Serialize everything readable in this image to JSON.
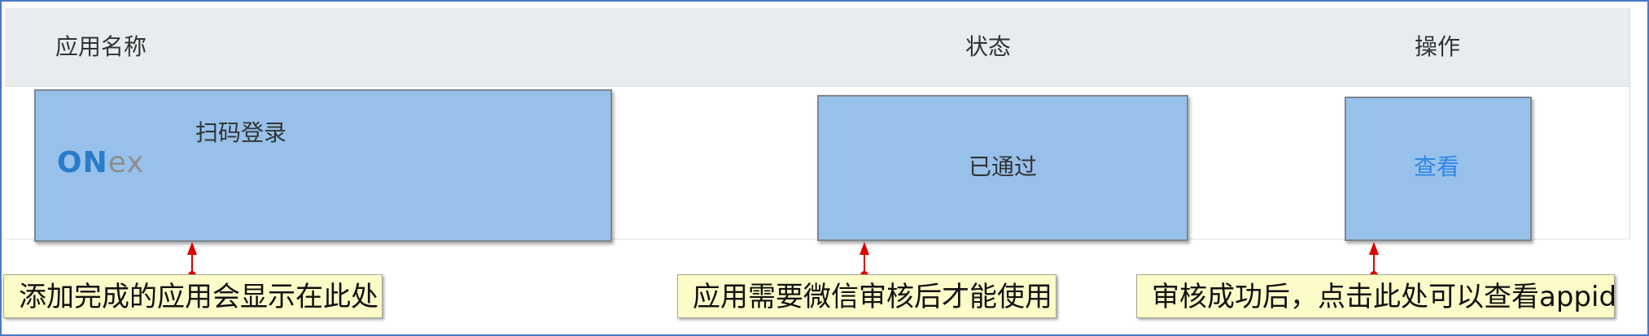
{
  "table": {
    "headers": {
      "name": "应用名称",
      "status": "状态",
      "action": "操作"
    },
    "row": {
      "logo_text_on": "ON",
      "logo_text_ex": "ex",
      "app_name": "扫码登录",
      "status": "已通过",
      "action_link": "查看"
    }
  },
  "annotations": {
    "note_app": "添加完成的应用会显示在此处",
    "note_status": "应用需要微信审核后才能使用",
    "note_action": "审核成功后，点击此处可以查看appid"
  },
  "colors": {
    "highlight": "#97c1ea",
    "header_bg": "#e9ecef",
    "link": "#2f86e6",
    "arrow": "#dd0000",
    "note_bg": "#fdfcc8"
  },
  "icons": [
    "onex-logo",
    "red-arrow"
  ]
}
